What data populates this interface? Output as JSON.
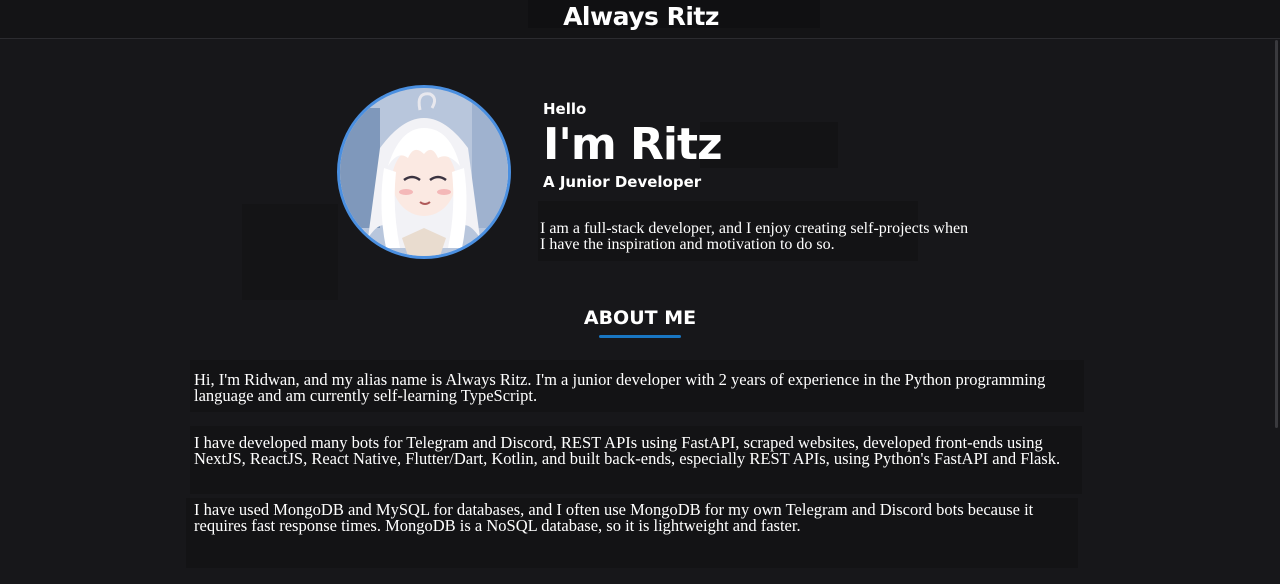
{
  "header": {
    "brand": "Always Ritz"
  },
  "profile": {
    "avatar_icon": "anime-avatar-icon",
    "avatar_border_color": "#4a8fe0",
    "greeting": "Hello",
    "name": "I'm Ritz",
    "role": "A Junior Developer",
    "intro": "I am a full-stack developer, and I enjoy creating self-projects when I have the inspiration and motivation to do so."
  },
  "about": {
    "title": "ABOUT ME",
    "underline_color": "#1976c2",
    "paragraphs": [
      "Hi, I'm Ridwan, and my alias name is Always Ritz. I'm a junior developer with 2 years of experience in the Python programming language and am currently self-learning TypeScript.",
      "I have developed many bots for Telegram and Discord, REST APIs using FastAPI, scraped websites, developed front-ends using NextJS, ReactJS, React Native, Flutter/Dart, Kotlin, and built back-ends, especially REST APIs, using Python's FastAPI and Flask.",
      "I have used MongoDB and MySQL for databases, and I often use MongoDB for my own Telegram and Discord bots because it requires fast response times. MongoDB is a NoSQL database, so it is lightweight and faster."
    ]
  },
  "theme": {
    "background": "#17171a",
    "text": "#ffffff"
  }
}
